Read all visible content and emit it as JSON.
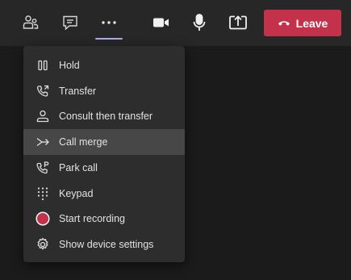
{
  "toolbar": {
    "buttons": [
      {
        "icon": "people-icon"
      },
      {
        "icon": "chat-icon"
      },
      {
        "icon": "more-options-icon"
      },
      {
        "icon": "camera-icon"
      },
      {
        "icon": "microphone-icon"
      },
      {
        "icon": "share-screen-icon"
      }
    ],
    "leave": {
      "label": "Leave",
      "icon": "hang-up-icon",
      "color": "#c4314b"
    },
    "active_underline_color": "#a9aaf0"
  },
  "menu": {
    "items": [
      {
        "label": "Hold",
        "icon": "pause-icon"
      },
      {
        "label": "Transfer",
        "icon": "transfer-call-icon"
      },
      {
        "label": "Consult then transfer",
        "icon": "consult-person-icon"
      },
      {
        "label": "Call merge",
        "icon": "merge-arrow-icon",
        "highlighted": true
      },
      {
        "label": "Park call",
        "icon": "park-call-icon"
      },
      {
        "label": "Keypad",
        "icon": "dialpad-icon"
      },
      {
        "label": "Start recording",
        "icon": "record-icon",
        "icon_color": "#c4314b"
      },
      {
        "label": "Show device settings",
        "icon": "settings-gear-icon"
      }
    ]
  },
  "colors": {
    "background": "#1b1b1b",
    "toolbar": "#272727",
    "menu": "#2d2d2d",
    "menu_hover": "#474747"
  }
}
